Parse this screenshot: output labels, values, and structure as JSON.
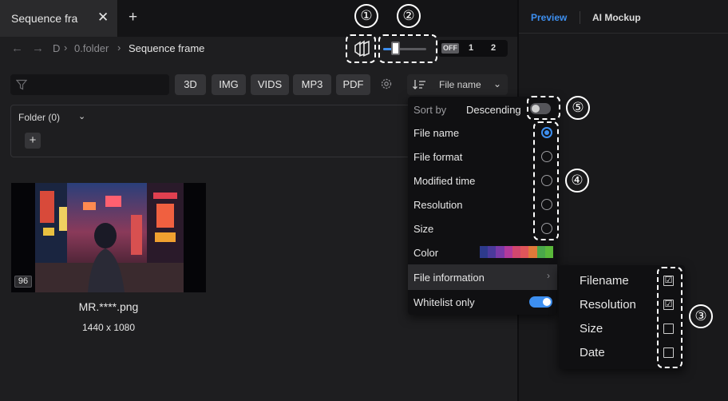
{
  "tab": {
    "title": "Sequence fra",
    "close": "✕",
    "add": "+"
  },
  "right_panel": {
    "preview_tab": "Preview",
    "ai_tab": "AI Mockup"
  },
  "breadcrumb": {
    "back": "←",
    "forward": "→",
    "drive": "D",
    "sep": "›",
    "folder": "0.folder",
    "current": "Sequence frame"
  },
  "toolbar": {
    "icons": [
      "stack-icon",
      "gear-icon",
      "filter-icon",
      "sort-icon"
    ],
    "slider_level": 0.2,
    "toggle": {
      "off": "OFF",
      "one": "1",
      "two": "2"
    }
  },
  "filter": {
    "placeholder": "",
    "types": [
      "3D",
      "IMG",
      "VIDS",
      "MP3",
      "PDF"
    ]
  },
  "sort": {
    "label": "File name",
    "chevron": "⌄"
  },
  "folder": {
    "label": "Folder (0)",
    "chevron": "⌄",
    "add": "+"
  },
  "file": {
    "badge": "96",
    "name": "MR.****.png",
    "dimensions": "1440 x 1080"
  },
  "menu": {
    "sort_by": "Sort by",
    "descending": "Descending",
    "descending_on": false,
    "options": [
      "File name",
      "File format",
      "Modified time",
      "Resolution",
      "Size"
    ],
    "selected_option": "File name",
    "color_label": "Color",
    "colors": [
      "#2d3a8c",
      "#4b3a9c",
      "#7a3aa8",
      "#b23a9c",
      "#d2476e",
      "#e0555a",
      "#e07a3a",
      "#4aa84a",
      "#5ab83a"
    ],
    "file_information": "File information",
    "chevron": "›",
    "whitelist": "Whitelist only",
    "whitelist_on": true
  },
  "submenu": {
    "items": [
      {
        "label": "Filename",
        "checked": true
      },
      {
        "label": "Resolution",
        "checked": true
      },
      {
        "label": "Size",
        "checked": false
      },
      {
        "label": "Date",
        "checked": false
      }
    ],
    "check": "☑"
  },
  "annotations": [
    "①",
    "②",
    "③",
    "④",
    "⑤"
  ],
  "accent": "#3d8ff0"
}
